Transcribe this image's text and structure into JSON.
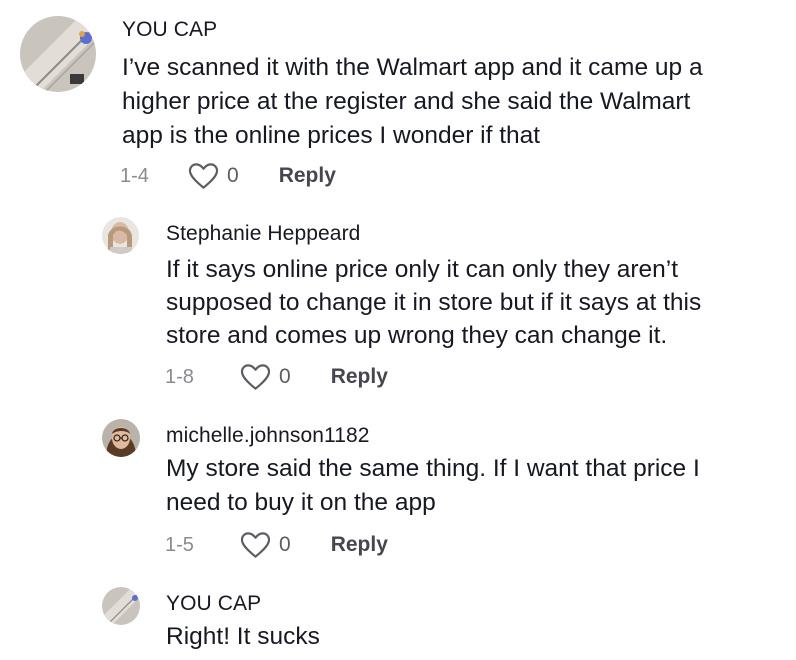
{
  "comments": [
    {
      "username": "YOU CAP",
      "lines": [
        "I’ve scanned it with the Walmart app and it came up a",
        "higher price at the register and she said the Walmart",
        "app is the online prices I wonder if that"
      ],
      "date": "1-4",
      "likes": "0",
      "reply": "Reply"
    },
    {
      "username": "Stephanie Heppeard",
      "lines": [
        "If it says online price only it can only they aren’t",
        "supposed to change it in store but if it says at this",
        "store and comes up wrong they can change it."
      ],
      "date": "1-8",
      "likes": "0",
      "reply": "Reply"
    },
    {
      "username": "michelle.johnson1182",
      "lines": [
        "My store said the same thing. If I want that price I",
        "need to buy it on the app"
      ],
      "date": "1-5",
      "likes": "0",
      "reply": "Reply"
    },
    {
      "username": "YOU CAP",
      "lines": [
        "Right! It sucks"
      ],
      "date": null,
      "likes": null,
      "reply": null
    }
  ],
  "colors": {
    "text": "#161823",
    "muted": "#8a8b91",
    "reply": "#454650"
  },
  "icons": {
    "like": "heart-outline-icon"
  }
}
